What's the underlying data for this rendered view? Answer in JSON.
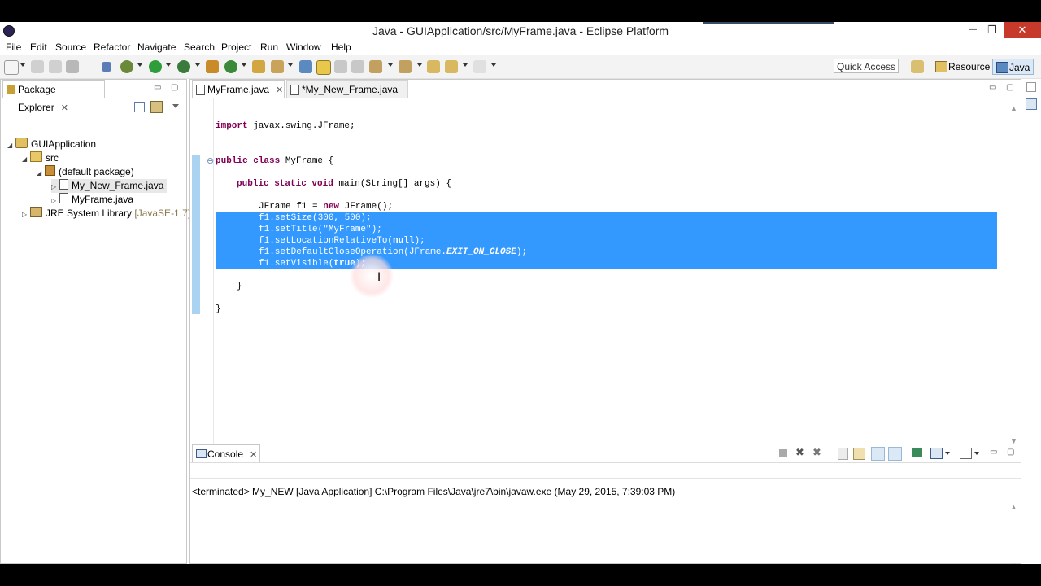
{
  "window": {
    "title": "Java - GUIApplication/src/MyFrame.java - Eclipse Platform",
    "minimize": "—",
    "maximize": "❐",
    "close": "✕"
  },
  "menu": {
    "items": [
      "File",
      "Edit",
      "Source",
      "Refactor",
      "Navigate",
      "Search",
      "Project",
      "Run",
      "Window",
      "Help"
    ]
  },
  "toolbar": {
    "quick_access": "Quick Access",
    "perspective_resource": "Resource",
    "perspective_java": "Java"
  },
  "package_explorer": {
    "tab_label": "Package Explorer",
    "tree": [
      {
        "label": "GUIApplication",
        "icon": "project-icon"
      },
      {
        "label": "src",
        "icon": "source-folder-icon"
      },
      {
        "label": "(default package)",
        "icon": "package-icon"
      },
      {
        "label": "My_New_Frame.java",
        "icon": "java-file-icon"
      },
      {
        "label": "MyFrame.java",
        "icon": "java-file-icon"
      },
      {
        "label": "JRE System Library",
        "suffix": "[JavaSE-1.7]",
        "icon": "library-icon"
      }
    ]
  },
  "editor": {
    "tabs": [
      {
        "label": "MyFrame.java",
        "active": true
      },
      {
        "label": "*My_New_Frame.java",
        "active": false
      }
    ],
    "code": {
      "import_kw": "import",
      "import_rest": " javax.swing.JFrame;",
      "class_kw": "public class",
      "class_rest": " MyFrame {",
      "main_kw1": "public static void",
      "main_rest": " main(String[] args) {",
      "line_jframe_a": "JFrame f1 = ",
      "line_jframe_kw": "new",
      "line_jframe_b": " JFrame();",
      "line_setsize": "f1.setSize(300, 500);",
      "line_settitle_a": "f1.setTitle(",
      "line_settitle_str": "\"MyFrame\"",
      "line_settitle_b": ");",
      "line_setloc_a": "f1.setLocationRelativeTo(",
      "line_setloc_kw": "null",
      "line_setloc_b": ");",
      "line_close_a": "f1.setDefaultCloseOperation(JFrame.",
      "line_close_field": "EXIT_ON_CLOSE",
      "line_close_b": ");",
      "line_visible_a": "f1.setVisible(",
      "line_visible_kw": "true",
      "line_visible_b": ");",
      "close_method": "}",
      "close_class": "}",
      "fold_marker": "⊖"
    }
  },
  "console": {
    "tab_label": "Console",
    "status": "<terminated> My_NEW [Java Application] C:\\Program Files\\Java\\jre7\\bin\\javaw.exe (May 29, 2015, 7:39:03 PM)"
  }
}
